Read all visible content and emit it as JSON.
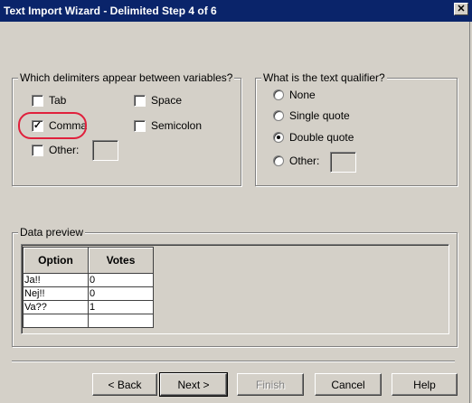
{
  "window": {
    "title": "Text Import Wizard - Delimited Step 4 of 6",
    "close_glyph": "✕"
  },
  "delimiters": {
    "legend": "Which delimiters appear between variables?",
    "tab": {
      "label": "Tab",
      "checked": false
    },
    "space": {
      "label": "Space",
      "checked": false
    },
    "comma": {
      "label": "Comma",
      "checked": true,
      "mark": "✓"
    },
    "semicolon": {
      "label": "Semicolon",
      "checked": false
    },
    "other": {
      "label": "Other:",
      "checked": false,
      "value": ""
    }
  },
  "qualifier": {
    "legend": "What is the text qualifier?",
    "options": [
      {
        "label": "None",
        "selected": false
      },
      {
        "label": "Single quote",
        "selected": false
      },
      {
        "label": "Double quote",
        "selected": true
      },
      {
        "label": "Other:",
        "selected": false
      }
    ],
    "other_value": ""
  },
  "preview": {
    "legend": "Data preview",
    "columns": [
      "Option",
      "Votes"
    ],
    "rows": [
      [
        "Ja!!",
        "0"
      ],
      [
        "Nej!!",
        "0"
      ],
      [
        "Va??",
        "1"
      ],
      [
        "",
        ""
      ]
    ]
  },
  "annotation_color": "#e0203c",
  "buttons": {
    "back": "< Back",
    "next": "Next >",
    "finish": "Finish",
    "cancel": "Cancel",
    "help": "Help"
  }
}
